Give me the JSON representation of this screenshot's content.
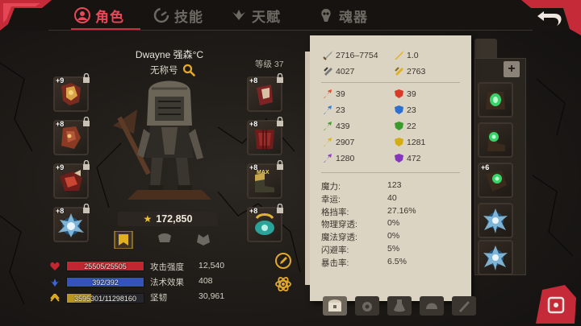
{
  "tabs": [
    {
      "label": "角色",
      "icon": "character-icon",
      "active": true
    },
    {
      "label": "技能",
      "icon": "skill-icon",
      "active": false
    },
    {
      "label": "天赋",
      "icon": "talent-icon",
      "active": false
    },
    {
      "label": "魂器",
      "icon": "soul-vessel-icon",
      "active": false
    }
  ],
  "character": {
    "name": "Dwayne 强森°C",
    "title": "无称号",
    "level_label": "等级 37",
    "power": "172,850"
  },
  "equipment_left": [
    {
      "enhance": "+9",
      "icon": "gloves-icon"
    },
    {
      "enhance": "+8",
      "icon": "bracer-icon"
    },
    {
      "enhance": "+9",
      "icon": "gauntlet-icon"
    },
    {
      "enhance": "+8",
      "icon": "rune-icon"
    }
  ],
  "equipment_right": [
    {
      "enhance": "+8",
      "icon": "helmet-icon"
    },
    {
      "enhance": "+8",
      "icon": "armor-icon"
    },
    {
      "enhance": "+8",
      "icon": "boots-icon"
    },
    {
      "enhance": "+8",
      "icon": "amulet-icon"
    }
  ],
  "resources": [
    {
      "icon": "heart-icon",
      "text": "25505/25505",
      "fill": 1.0,
      "color": "#c22631"
    },
    {
      "icon": "mana-icon",
      "text": "392/392",
      "fill": 1.0,
      "color": "#3553b8"
    },
    {
      "icon": "xp-icon",
      "text": "3595301/11298160",
      "fill": 0.318,
      "color": "#b8961f"
    }
  ],
  "core_attributes": [
    {
      "label": "攻击强度",
      "value": "12,540"
    },
    {
      "label": "法术效果",
      "value": "408"
    },
    {
      "label": "坚韧",
      "value": "30,961"
    }
  ],
  "stats_panel": {
    "top": [
      {
        "icon": "attack-icon",
        "value": "2716–7754"
      },
      {
        "icon": "attack-speed-icon",
        "value": "1.0"
      },
      {
        "icon": "armor-stat-icon",
        "value": "4027"
      },
      {
        "icon": "magic-defense-icon",
        "value": "2763"
      }
    ],
    "resist": [
      {
        "icon": "fire-icon",
        "value": "39",
        "color": "#e04a2a"
      },
      {
        "icon": "fire-res-icon",
        "value": "39",
        "color": "#d83a2a"
      },
      {
        "icon": "frost-icon",
        "value": "23",
        "color": "#2f7bd6"
      },
      {
        "icon": "frost-res-icon",
        "value": "23",
        "color": "#2f6fd0"
      },
      {
        "icon": "poison-icon",
        "value": "439",
        "color": "#3f9a2a"
      },
      {
        "icon": "poison-res-icon",
        "value": "22",
        "color": "#3a9a2c"
      },
      {
        "icon": "lightning-icon",
        "value": "2907",
        "color": "#d8b418"
      },
      {
        "icon": "lightning-res-icon",
        "value": "1281",
        "color": "#d4ad14"
      },
      {
        "icon": "shadow-icon",
        "value": "1280",
        "color": "#8a3ac4"
      },
      {
        "icon": "shadow-res-icon",
        "value": "472",
        "color": "#8436bd"
      }
    ],
    "attributes": [
      {
        "label": "魔力:",
        "value": "123"
      },
      {
        "label": "幸运:",
        "value": "40"
      },
      {
        "label": "格挡率:",
        "value": "27.16%"
      },
      {
        "label": "物理穿透:",
        "value": "0%"
      },
      {
        "label": "魔法穿透:",
        "value": "0%"
      },
      {
        "label": "闪避率:",
        "value": "5%"
      },
      {
        "label": "暴击率:",
        "value": "6.5%"
      }
    ]
  },
  "inventory": {
    "add_label": "+",
    "items": [
      {
        "enhance": "",
        "icon": "green-gem-helm-icon"
      },
      {
        "enhance": "",
        "icon": "green-gem-boots-icon"
      },
      {
        "enhance": "+6",
        "icon": "green-gem-gauntlet-icon"
      },
      {
        "enhance": "",
        "icon": "spiked-rune-icon"
      },
      {
        "enhance": "",
        "icon": "spiked-rune-icon"
      }
    ]
  },
  "bottom_tabs": [
    "chest-icon",
    "gem-bag-icon",
    "potion-icon",
    "helmet-bag-icon",
    "scroll-icon"
  ]
}
